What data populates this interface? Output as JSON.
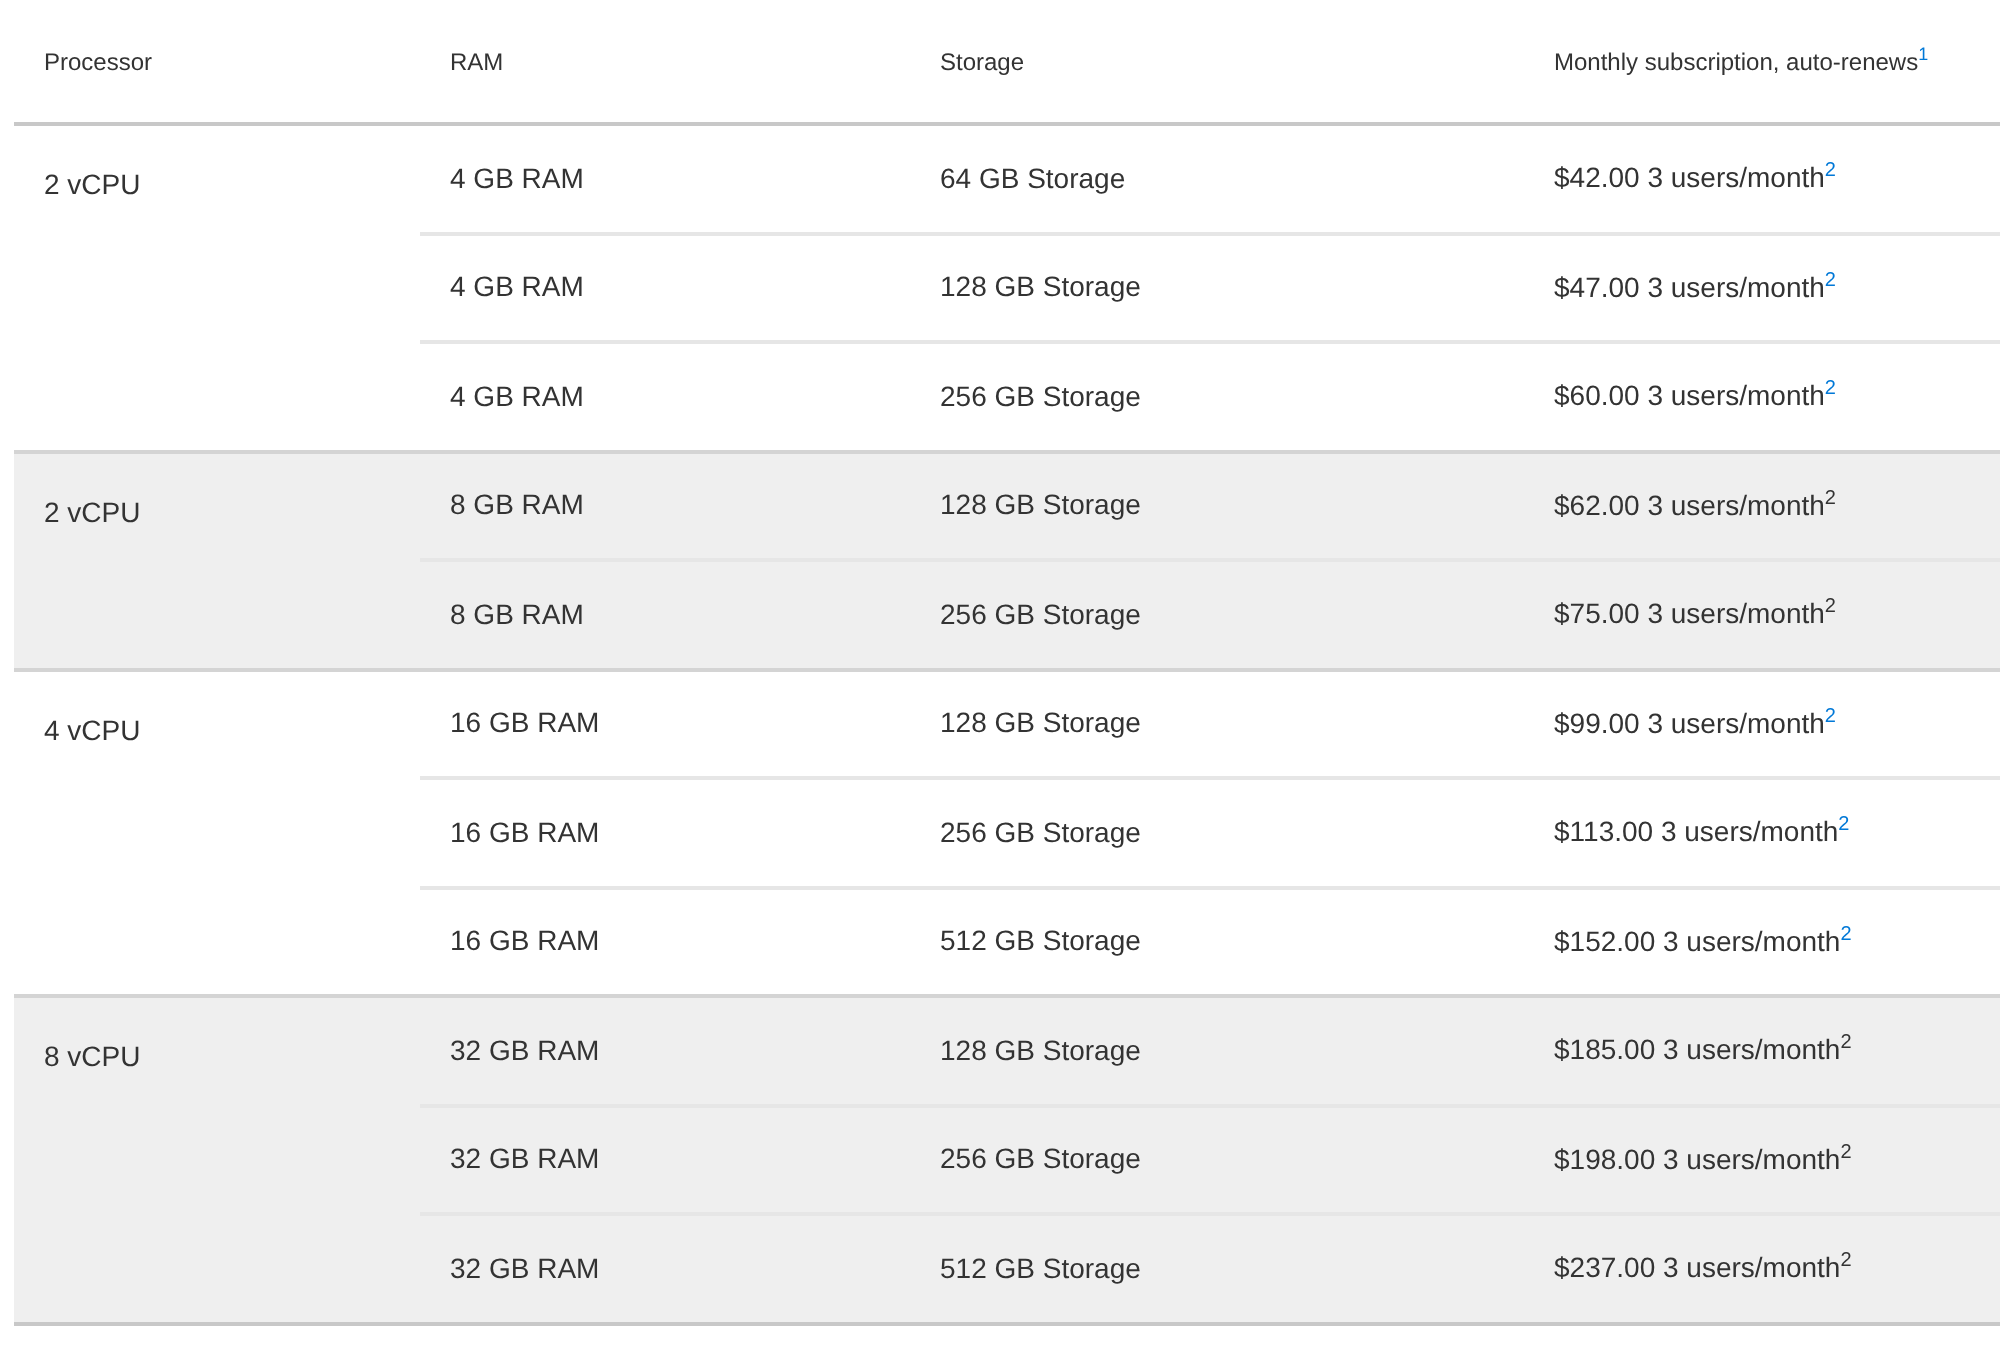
{
  "table": {
    "columns": [
      {
        "label": "Processor"
      },
      {
        "label": "RAM"
      },
      {
        "label": "Storage"
      },
      {
        "label": "Monthly subscription, auto-renews",
        "note": "1"
      }
    ],
    "groups": [
      {
        "processor": "2 vCPU",
        "shaded": false,
        "rows": [
          {
            "ram": "4 GB RAM",
            "storage": "64 GB Storage",
            "price": "$42.00 3 users/month",
            "note": "2"
          },
          {
            "ram": "4 GB RAM",
            "storage": "128 GB Storage",
            "price": "$47.00 3 users/month",
            "note": "2"
          },
          {
            "ram": "4 GB RAM",
            "storage": "256 GB Storage",
            "price": "$60.00 3 users/month",
            "note": "2"
          }
        ]
      },
      {
        "processor": "2 vCPU",
        "shaded": true,
        "rows": [
          {
            "ram": "8 GB RAM",
            "storage": "128 GB Storage",
            "price": "$62.00 3 users/month",
            "note": "2"
          },
          {
            "ram": "8 GB RAM",
            "storage": "256 GB Storage",
            "price": "$75.00 3 users/month",
            "note": "2"
          }
        ]
      },
      {
        "processor": "4 vCPU",
        "shaded": false,
        "rows": [
          {
            "ram": "16 GB RAM",
            "storage": "128 GB Storage",
            "price": "$99.00 3 users/month",
            "note": "2"
          },
          {
            "ram": "16 GB RAM",
            "storage": "256 GB Storage",
            "price": "$113.00 3 users/month",
            "note": "2"
          },
          {
            "ram": "16 GB RAM",
            "storage": "512 GB Storage",
            "price": "$152.00 3 users/month",
            "note": "2"
          }
        ]
      },
      {
        "processor": "8 vCPU",
        "shaded": true,
        "rows": [
          {
            "ram": "32 GB RAM",
            "storage": "128 GB Storage",
            "price": "$185.00 3 users/month",
            "note": "2"
          },
          {
            "ram": "32 GB RAM",
            "storage": "256 GB Storage",
            "price": "$198.00 3 users/month",
            "note": "2"
          },
          {
            "ram": "32 GB RAM",
            "storage": "512 GB Storage",
            "price": "$237.00 3 users/month",
            "note": "2"
          }
        ]
      }
    ]
  }
}
